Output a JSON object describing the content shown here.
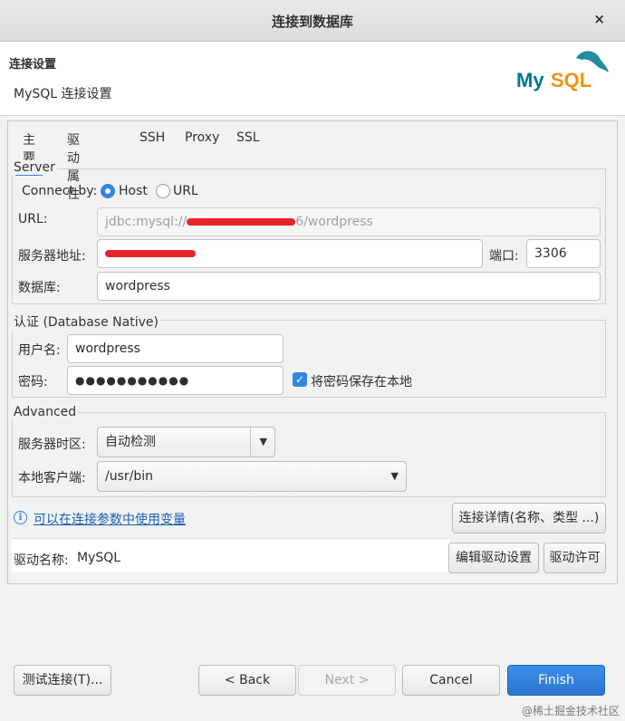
{
  "window": {
    "title": "连接到数据库",
    "close_label": "×"
  },
  "header": {
    "title": "连接设置",
    "description": "MySQL 连接设置",
    "logo_text_my": "My",
    "logo_text_sql": "SQL",
    "logo_color_my": "#00758F",
    "logo_color_sql": "#F29111"
  },
  "tabs": [
    {
      "label": "主要",
      "active": true
    },
    {
      "label": "驱动属性",
      "active": false
    },
    {
      "label": "SSH",
      "active": false
    },
    {
      "label": "Proxy",
      "active": false
    },
    {
      "label": "SSL",
      "active": false
    }
  ],
  "server": {
    "group_label": "Server",
    "connect_by_label": "Connect by:",
    "option_host": "Host",
    "option_url": "URL",
    "selected": "Host",
    "url_label": "URL:",
    "url_prefix": "jdbc:mysql://",
    "url_suffix": "6/wordpress",
    "host_label": "服务器地址:",
    "port_label": "端口:",
    "port_value": "3306",
    "database_label": "数据库:",
    "database_value": "wordpress"
  },
  "auth": {
    "group_label": "认证 (Database Native)",
    "username_label": "用户名:",
    "username_value": "wordpress",
    "password_label": "密码:",
    "password_value": "●●●●●●●●●●●",
    "save_password_label": "将密码保存在本地",
    "save_password_checked": true
  },
  "advanced": {
    "group_label": "Advanced",
    "timezone_label": "服务器时区:",
    "timezone_value": "自动检测",
    "client_label": "本地客户端:",
    "client_value": "/usr/bin"
  },
  "variables_link": "可以在连接参数中使用变量",
  "connection_details_button": "连接详情(名称、类型 ...)",
  "driver": {
    "name_label": "驱动名称:",
    "name_value": "MySQL",
    "edit_button": "编辑驱动设置",
    "license_button": "驱动许可"
  },
  "footer": {
    "test_button": "测试连接(T)...",
    "back_button": "< Back",
    "next_button": "Next >",
    "cancel_button": "Cancel",
    "finish_button": "Finish"
  },
  "watermark": "@稀土掘金技术社区",
  "colors": {
    "accent": "#3584e4",
    "redaction": "#e8242b"
  }
}
